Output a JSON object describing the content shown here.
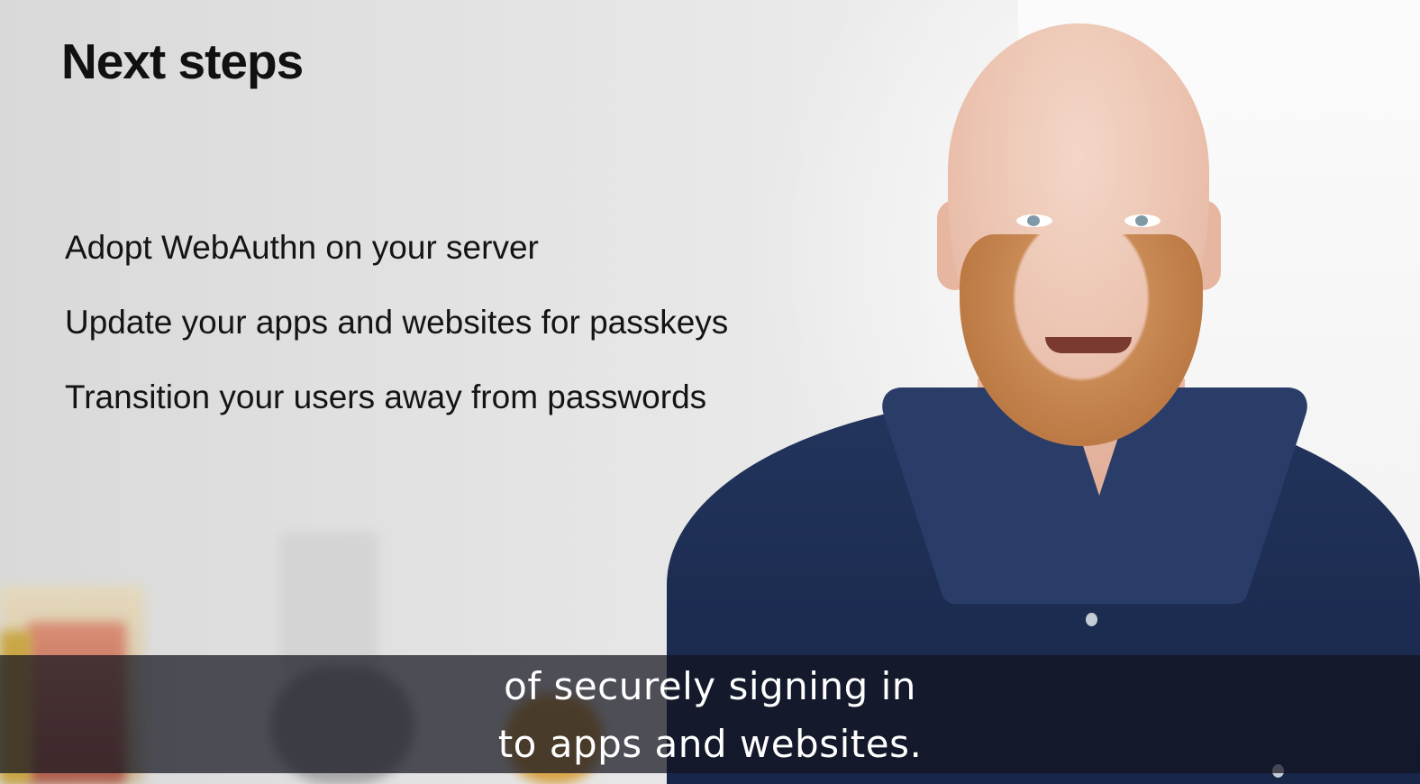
{
  "slide": {
    "title": "Next steps",
    "steps": [
      "Adopt WebAuthn on your server",
      "Update your apps and websites for passkeys",
      "Transition your users away from passwords"
    ]
  },
  "captions": {
    "line1": "of securely signing in",
    "line2": "to apps and websites."
  }
}
